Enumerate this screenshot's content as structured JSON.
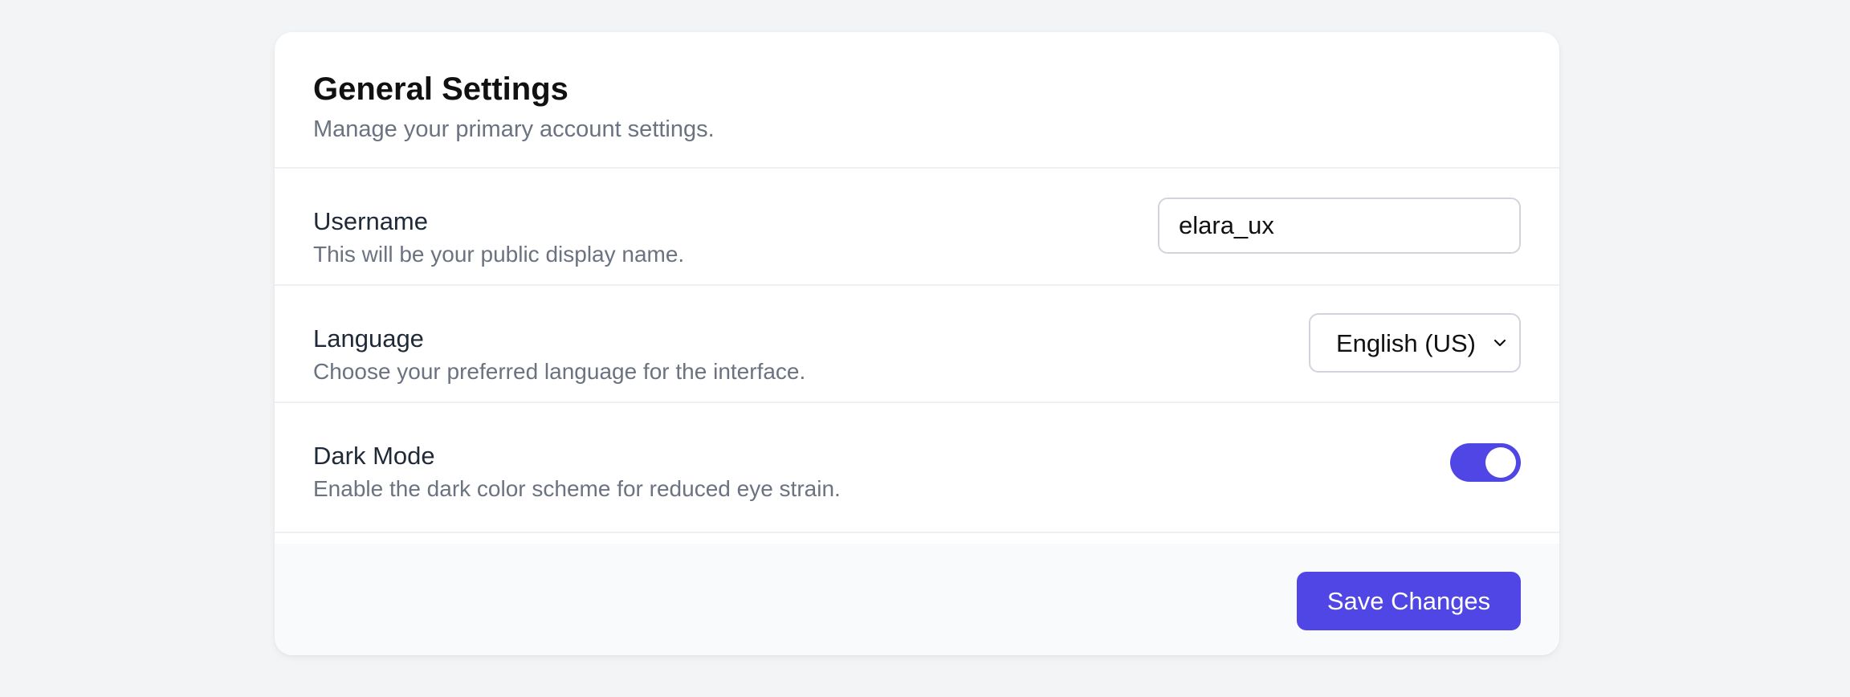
{
  "header": {
    "title": "General Settings",
    "subtitle": "Manage your primary account settings."
  },
  "settings": {
    "username": {
      "label": "Username",
      "description": "This will be your public display name.",
      "value": "elara_ux"
    },
    "language": {
      "label": "Language",
      "description": "Choose your preferred language for the interface.",
      "selected": "English (US)",
      "icon": "chevron-down-icon"
    },
    "dark_mode": {
      "label": "Dark Mode",
      "description": "Enable the dark color scheme for reduced eye strain.",
      "enabled": true
    }
  },
  "footer": {
    "save_label": "Save Changes"
  },
  "colors": {
    "accent": "#4f46e5",
    "background": "#f3f4f6",
    "card": "#ffffff",
    "footer": "#f9fafb",
    "muted_text": "#6b7280"
  }
}
